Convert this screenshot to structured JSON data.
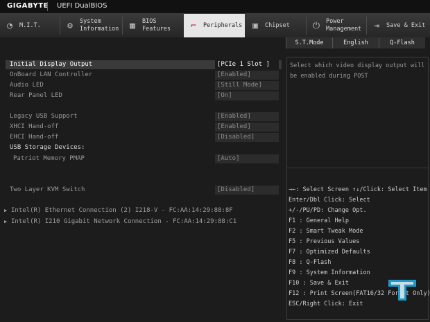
{
  "header": {
    "brand": "GIGABYTE",
    "title": "UEFI DualBIOS"
  },
  "tabs": [
    {
      "line1": "M.I.T.",
      "line2": "",
      "icon": "gauge-icon"
    },
    {
      "line1": "System",
      "line2": "Information",
      "icon": "gear-icon"
    },
    {
      "line1": "BIOS",
      "line2": "Features",
      "icon": "chip-icon"
    },
    {
      "line1": "Peripherals",
      "line2": "",
      "icon": "plug-icon",
      "active": true
    },
    {
      "line1": "Chipset",
      "line2": "",
      "icon": "chipset-icon"
    },
    {
      "line1": "Power",
      "line2": "Management",
      "icon": "power-icon"
    },
    {
      "line1": "Save & Exit",
      "line2": "",
      "icon": "exit-icon"
    }
  ],
  "toolbar": {
    "stmode": "S.T.Mode",
    "language": "English",
    "qflash": "Q-Flash"
  },
  "settings": [
    {
      "label": "Initial Display Output",
      "value": "[PCIe 1 Slot ]"
    },
    {
      "label": "OnBoard LAN Controller",
      "value": "[Enabled]"
    },
    {
      "label": "Audio LED",
      "value": "[Still Mode]"
    },
    {
      "label": "Rear Panel LED",
      "value": "[On]"
    },
    {
      "label": "Legacy USB Support",
      "value": "[Enabled]"
    },
    {
      "label": "XHCI Hand-off",
      "value": "[Enabled]"
    },
    {
      "label": "EHCI Hand-off",
      "value": "[Disabled]"
    },
    {
      "label": "USB Storage Devices:",
      "value": ""
    },
    {
      "label": "Patriot Memory PMAP",
      "value": "[Auto]"
    },
    {
      "label": "Two Layer KVM Switch",
      "value": "[Disabled]"
    }
  ],
  "links": [
    "Intel(R) Ethernet Connection (2) I218-V - FC:AA:14:29:88:8F",
    "Intel(R) I210 Gigabit  Network Connection - FC:AA:14:29:88:C1"
  ],
  "help": {
    "text": "Select which video display output will be enabled during POST"
  },
  "keys": [
    "→←: Select Screen  ↑↓/Click: Select Item",
    "Enter/Dbl Click: Select",
    "+/-/PU/PD: Change Opt.",
    "F1  : General Help",
    "F2  : Smart Tweak Mode",
    "F5  : Previous Values",
    "F7  : Optimized Defaults",
    "F8  : Q-Flash",
    "F9  : System Information",
    "F10 : Save & Exit",
    "F12 : Print Screen(FAT16/32 Format Only)",
    "ESC/Right Click: Exit"
  ],
  "colors": {
    "accent": "#c8102e",
    "active_tab": "#e6e6e6",
    "background": "#1c1c1c",
    "logo_blue": "#1fa3d6"
  }
}
